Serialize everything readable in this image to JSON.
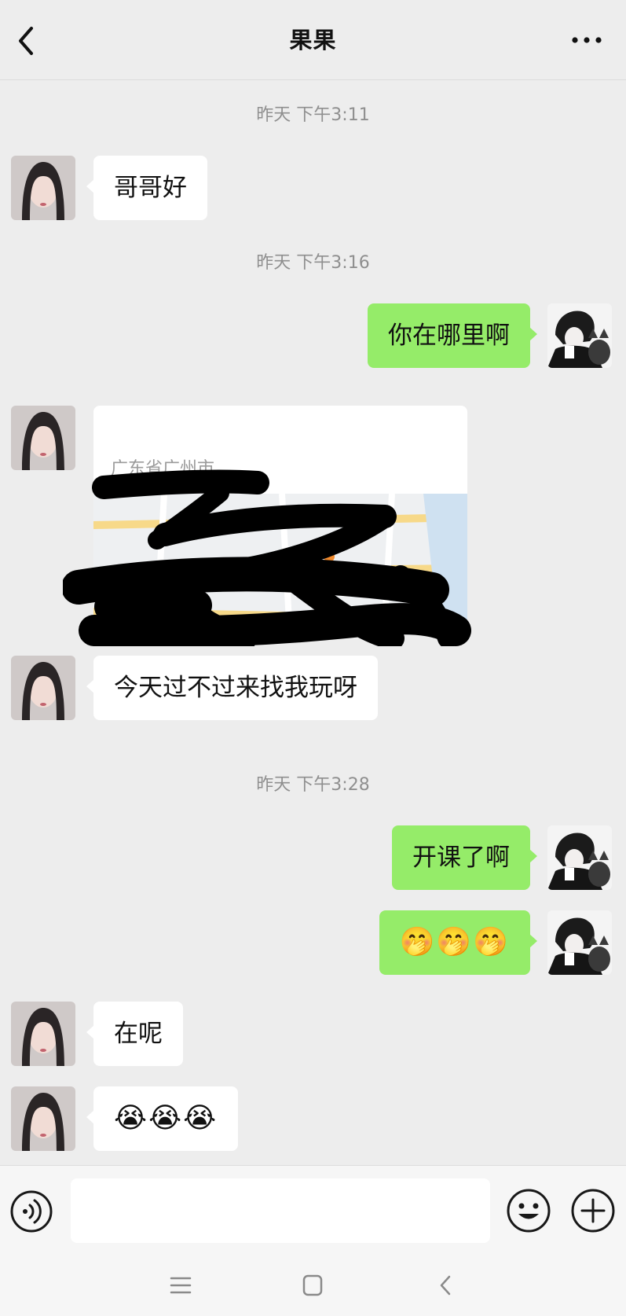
{
  "header": {
    "title": "果果",
    "back_icon": "chevron-left-icon",
    "more_icon": "more-dots-icon"
  },
  "messages": [
    {
      "type": "time",
      "text": "昨天 下午3:11"
    },
    {
      "type": "in",
      "text": "哥哥好"
    },
    {
      "type": "time",
      "text": "昨天 下午3:16"
    },
    {
      "type": "out",
      "text": "你在哪里啊"
    },
    {
      "type": "location",
      "address": "广东省广州市"
    },
    {
      "type": "in",
      "text": "今天过不过来找我玩呀"
    },
    {
      "type": "time",
      "text": "昨天 下午3:28"
    },
    {
      "type": "out",
      "text": "开课了啊"
    },
    {
      "type": "out",
      "text": "🤭🤭🤭"
    },
    {
      "type": "in",
      "text": "在呢"
    },
    {
      "type": "in",
      "text": "😭😭😭"
    }
  ],
  "input": {
    "placeholder": ""
  },
  "icons": {
    "voice": "voice-icon",
    "emoji": "emoji-icon",
    "plus": "plus-icon"
  },
  "colors": {
    "sent_bubble": "#95ec69",
    "received_bubble": "#ffffff",
    "background": "#ededed"
  }
}
